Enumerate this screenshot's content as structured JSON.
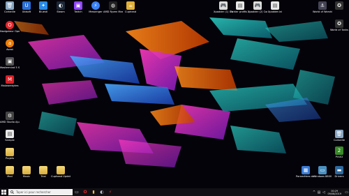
{
  "desktop_icons": [
    {
      "id": "corbeille",
      "label": "Corbeille",
      "type": "trash"
    },
    {
      "id": "ubisoft",
      "label": "Ubisoft",
      "type": "app",
      "color": "#2a6fd6"
    },
    {
      "id": "bluestl",
      "label": "Bluestl",
      "type": "app",
      "color": "#2b8be6"
    },
    {
      "id": "steam",
      "label": "Steam",
      "type": "app",
      "color": "#1b2838"
    },
    {
      "id": "twitch",
      "label": "Twitch",
      "type": "app",
      "color": "#9146ff"
    },
    {
      "id": "messenger",
      "label": "Messenger",
      "type": "app",
      "color": "#3b82f6"
    },
    {
      "id": "amd-ryzen-master",
      "label": "AMD Ryzen Master",
      "type": "app",
      "color": "#222"
    },
    {
      "id": "cuphead",
      "label": "Cuphead",
      "type": "app",
      "color": "#e0b13a"
    },
    {
      "id": "manette-1",
      "label": "Xpadder (1) Cont...",
      "type": "gamepad"
    },
    {
      "id": "fichier-1",
      "label": "Fichier profils Xp...",
      "type": "file"
    },
    {
      "id": "manette-2",
      "label": "Xpadder (2) Cont...",
      "type": "gamepad"
    },
    {
      "id": "fichier-2",
      "label": "Xpadder.ini",
      "type": "file"
    },
    {
      "id": "world-warships",
      "label": "World of Warshi...",
      "type": "app",
      "color": "#445"
    },
    {
      "id": "world-tanks",
      "label": "World of Tanks",
      "type": "app",
      "color": "#333"
    },
    {
      "id": "navigator",
      "label": "Navigateur Opera",
      "type": "app",
      "color": "#e3262b"
    },
    {
      "id": "avast",
      "label": "Avast",
      "type": "app",
      "color": "#f07d00"
    },
    {
      "id": "maxcso",
      "label": "Mastermind 5 Suite",
      "type": "app",
      "color": "#555"
    },
    {
      "id": "malwarebytes",
      "label": "Malwarebytes",
      "type": "app",
      "color": "#d92027"
    },
    {
      "id": "amd-radeon",
      "label": "AMD Studio Ajustes",
      "type": "app",
      "color": "#444"
    },
    {
      "id": "sample",
      "label": "Sample",
      "type": "file"
    },
    {
      "id": "projets",
      "label": "Projets",
      "type": "folder"
    },
    {
      "id": "recycle-bin-right",
      "label": "Corbeille",
      "type": "trash"
    },
    {
      "id": "pcsx2",
      "label": "PcsX2",
      "type": "app",
      "color": "#3a8a2a"
    },
    {
      "id": "mod",
      "label": "Mod",
      "type": "folder"
    },
    {
      "id": "music",
      "label": "Music",
      "type": "folder"
    },
    {
      "id": "trial",
      "label": "Trial",
      "type": "folder"
    },
    {
      "id": "cuphead-update",
      "label": "Cuphead Update",
      "type": "folder"
    },
    {
      "id": "parametres",
      "label": "Paramètres de configuration",
      "type": "app",
      "color": "#3a7bd5"
    },
    {
      "id": "windows-8800",
      "label": "Windows 8800",
      "type": "app",
      "color": "#4a90c0"
    },
    {
      "id": "drive",
      "label": "Drivers",
      "type": "app",
      "color": "#2d6a9f"
    }
  ],
  "taskbar": {
    "search_placeholder": "Taper ici pour rechercher",
    "apps": [
      {
        "name": "task-view",
        "symbol": "▭"
      },
      {
        "name": "opera",
        "symbol": "O",
        "color": "#e3262b"
      },
      {
        "name": "file-explorer",
        "symbol": "▮",
        "color": "#f0c040"
      },
      {
        "name": "steam",
        "symbol": "◐",
        "color": "#c7d5e0"
      },
      {
        "name": "amd",
        "symbol": "⚡",
        "color": "#e33"
      }
    ],
    "tray": {
      "chevron": "^",
      "time": "00:29",
      "date": "09/08/2019"
    }
  }
}
